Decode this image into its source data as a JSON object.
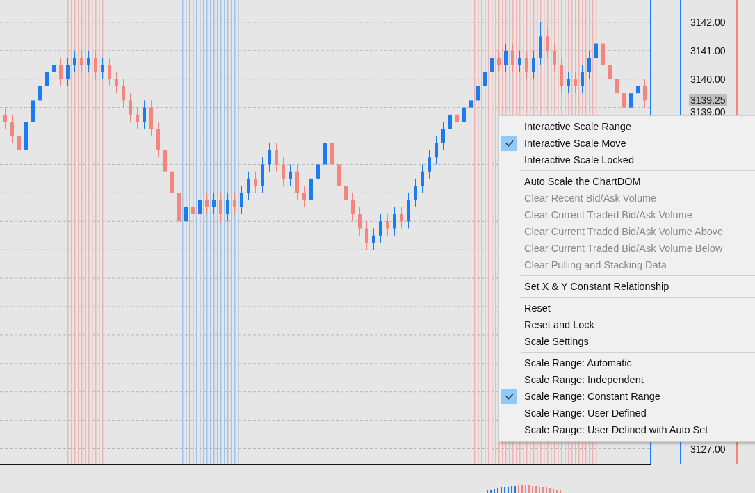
{
  "chart": {
    "current_price": "3139.25",
    "chart_data": {
      "type": "candlestick",
      "grid": true,
      "ylim": [
        3126.45,
        3142.78
      ],
      "yticks": [
        {
          "value": 3142,
          "label": "3142.00"
        },
        {
          "value": 3141,
          "label": "3141.00"
        },
        {
          "value": 3140,
          "label": "3140.00"
        },
        {
          "value": 3139,
          "label": "3139.00"
        },
        {
          "value": 3127,
          "label": "3127.00"
        }
      ],
      "ohlc": [
        [
          3138.75,
          3139,
          3138.25,
          3138.5
        ],
        [
          3138.5,
          3138.75,
          3137.75,
          3138
        ],
        [
          3138,
          3138.25,
          3137.25,
          3137.5
        ],
        [
          3137.5,
          3138.75,
          3137.25,
          3138.5
        ],
        [
          3138.5,
          3139.5,
          3138.25,
          3139.25
        ],
        [
          3139.25,
          3140,
          3139,
          3139.75
        ],
        [
          3139.75,
          3140.5,
          3139.5,
          3140.25
        ],
        [
          3140.25,
          3140.75,
          3140,
          3140.5
        ],
        [
          3140.5,
          3140.75,
          3139.75,
          3140
        ],
        [
          3140,
          3140.75,
          3139.75,
          3140.5
        ],
        [
          3140.5,
          3141,
          3140.25,
          3140.75
        ],
        [
          3140.75,
          3141,
          3140.25,
          3140.5
        ],
        [
          3140.5,
          3141,
          3140.25,
          3140.75
        ],
        [
          3140.75,
          3141,
          3140,
          3140.25
        ],
        [
          3140.25,
          3140.75,
          3140,
          3140.5
        ],
        [
          3140.5,
          3140.75,
          3139.75,
          3140
        ],
        [
          3140,
          3140.25,
          3139.5,
          3139.75
        ],
        [
          3139.75,
          3140,
          3139,
          3139.25
        ],
        [
          3139.25,
          3139.5,
          3138.5,
          3138.75
        ],
        [
          3138.75,
          3139,
          3138.25,
          3138.5
        ],
        [
          3138.5,
          3139.25,
          3138.25,
          3139
        ],
        [
          3139,
          3139.25,
          3138,
          3138.25
        ],
        [
          3138.25,
          3138.5,
          3137.25,
          3137.5
        ],
        [
          3137.5,
          3137.75,
          3136.5,
          3136.75
        ],
        [
          3136.75,
          3137,
          3135.75,
          3136
        ],
        [
          3136,
          3136.25,
          3134.75,
          3135
        ],
        [
          3135,
          3135.75,
          3134.75,
          3135.5
        ],
        [
          3135.5,
          3135.75,
          3135,
          3135.25
        ],
        [
          3135.25,
          3136,
          3135,
          3135.75
        ],
        [
          3135.75,
          3136,
          3135.25,
          3135.5
        ],
        [
          3135.5,
          3136,
          3135.25,
          3135.75
        ],
        [
          3135.75,
          3136,
          3135,
          3135.25
        ],
        [
          3135.25,
          3136,
          3135,
          3135.75
        ],
        [
          3135.75,
          3136,
          3135.25,
          3135.5
        ],
        [
          3135.5,
          3136.25,
          3135.25,
          3136
        ],
        [
          3136,
          3136.75,
          3135.75,
          3136.5
        ],
        [
          3136.5,
          3136.75,
          3136,
          3136.25
        ],
        [
          3136.25,
          3137.25,
          3136,
          3137
        ],
        [
          3137,
          3137.75,
          3136.75,
          3137.5
        ],
        [
          3137.5,
          3137.75,
          3136.75,
          3137
        ],
        [
          3137,
          3137.25,
          3136.25,
          3136.5
        ],
        [
          3136.5,
          3137,
          3136.25,
          3136.75
        ],
        [
          3136.75,
          3137,
          3135.75,
          3136
        ],
        [
          3136,
          3136.25,
          3135.5,
          3135.75
        ],
        [
          3135.75,
          3136.75,
          3135.5,
          3136.5
        ],
        [
          3136.5,
          3137.25,
          3136.25,
          3137
        ],
        [
          3137,
          3138,
          3136.75,
          3137.75
        ],
        [
          3137.75,
          3138,
          3136.75,
          3137
        ],
        [
          3137,
          3137.25,
          3136,
          3136.25
        ],
        [
          3136.25,
          3136.5,
          3135.5,
          3135.75
        ],
        [
          3135.75,
          3136,
          3135,
          3135.25
        ],
        [
          3135.25,
          3135.5,
          3134.5,
          3134.75
        ],
        [
          3134.75,
          3135,
          3134,
          3134.25
        ],
        [
          3134.25,
          3134.75,
          3134,
          3134.5
        ],
        [
          3134.5,
          3135.25,
          3134.25,
          3135
        ],
        [
          3135,
          3135.25,
          3134.5,
          3134.75
        ],
        [
          3134.75,
          3135.5,
          3134.5,
          3135.25
        ],
        [
          3135.25,
          3135.5,
          3134.75,
          3135
        ],
        [
          3135,
          3136,
          3134.75,
          3135.75
        ],
        [
          3135.75,
          3136.5,
          3135.5,
          3136.25
        ],
        [
          3136.25,
          3137,
          3136,
          3136.75
        ],
        [
          3136.75,
          3137.5,
          3136.5,
          3137.25
        ],
        [
          3137.25,
          3138,
          3137,
          3137.75
        ],
        [
          3137.75,
          3138.5,
          3137.5,
          3138.25
        ],
        [
          3138.25,
          3139,
          3138,
          3138.75
        ],
        [
          3138.75,
          3139,
          3138.25,
          3138.5
        ],
        [
          3138.5,
          3139.25,
          3138.25,
          3139
        ],
        [
          3139,
          3139.5,
          3138.75,
          3139.25
        ],
        [
          3139.25,
          3140,
          3139,
          3139.75
        ],
        [
          3139.75,
          3140.5,
          3139.5,
          3140.25
        ],
        [
          3140.25,
          3141,
          3140,
          3140.75
        ],
        [
          3140.75,
          3141,
          3140.25,
          3140.5
        ],
        [
          3140.5,
          3141.25,
          3140.25,
          3141
        ],
        [
          3141,
          3141.25,
          3140.25,
          3140.5
        ],
        [
          3140.5,
          3141,
          3140.25,
          3140.75
        ],
        [
          3140.75,
          3141,
          3140,
          3140.25
        ],
        [
          3140.25,
          3141,
          3140,
          3140.75
        ],
        [
          3140.75,
          3142,
          3140.5,
          3141.5
        ],
        [
          3141.5,
          3141.75,
          3140.75,
          3141
        ],
        [
          3141,
          3141.25,
          3140.25,
          3140.5
        ],
        [
          3140.5,
          3140.75,
          3139.5,
          3139.75
        ],
        [
          3139.75,
          3140.25,
          3139.5,
          3140
        ],
        [
          3140,
          3140.25,
          3139.5,
          3139.75
        ],
        [
          3139.75,
          3140.5,
          3139.5,
          3140.25
        ],
        [
          3140.25,
          3141,
          3140,
          3140.75
        ],
        [
          3140.75,
          3141.5,
          3140.5,
          3141.25
        ],
        [
          3141.25,
          3141.5,
          3140.25,
          3140.5
        ],
        [
          3140.5,
          3140.75,
          3139.75,
          3140
        ],
        [
          3140,
          3140.25,
          3139.25,
          3139.5
        ],
        [
          3139.5,
          3139.75,
          3138.75,
          3139
        ],
        [
          3139,
          3139.75,
          3138.75,
          3139.5
        ],
        [
          3139.5,
          3140,
          3139.25,
          3139.75
        ],
        [
          3139.75,
          3140,
          3139,
          3139.25
        ]
      ]
    }
  },
  "context_menu": {
    "sections": [
      [
        {
          "label": "Interactive Scale Range",
          "checked": false,
          "disabled": false
        },
        {
          "label": "Interactive Scale Move",
          "checked": true,
          "disabled": false
        },
        {
          "label": "Interactive Scale Locked",
          "checked": false,
          "disabled": false
        }
      ],
      [
        {
          "label": "Auto Scale the ChartDOM",
          "checked": false,
          "disabled": false
        },
        {
          "label": "Clear Recent Bid/Ask Volume",
          "checked": false,
          "disabled": true
        },
        {
          "label": "Clear Current Traded Bid/Ask Volume",
          "checked": false,
          "disabled": true
        },
        {
          "label": "Clear Current Traded Bid/Ask Volume Above",
          "checked": false,
          "disabled": true
        },
        {
          "label": "Clear Current Traded Bid/Ask Volume Below",
          "checked": false,
          "disabled": true
        },
        {
          "label": "Clear Pulling and Stacking Data",
          "checked": false,
          "disabled": true
        }
      ],
      [
        {
          "label": "Set X & Y Constant Relationship",
          "checked": false,
          "disabled": false
        }
      ],
      [
        {
          "label": "Reset",
          "checked": false,
          "disabled": false
        },
        {
          "label": "Reset and Lock",
          "checked": false,
          "disabled": false
        },
        {
          "label": "Scale Settings",
          "checked": false,
          "disabled": false
        }
      ],
      [
        {
          "label": "Scale Range: Automatic",
          "checked": false,
          "disabled": false
        },
        {
          "label": "Scale Range: Independent",
          "checked": false,
          "disabled": false
        },
        {
          "label": "Scale Range: Constant Range",
          "checked": true,
          "disabled": false
        },
        {
          "label": "Scale Range: User Defined",
          "checked": false,
          "disabled": false
        },
        {
          "label": "Scale Range: User Defined with Auto Set",
          "checked": false,
          "disabled": false
        }
      ]
    ]
  }
}
